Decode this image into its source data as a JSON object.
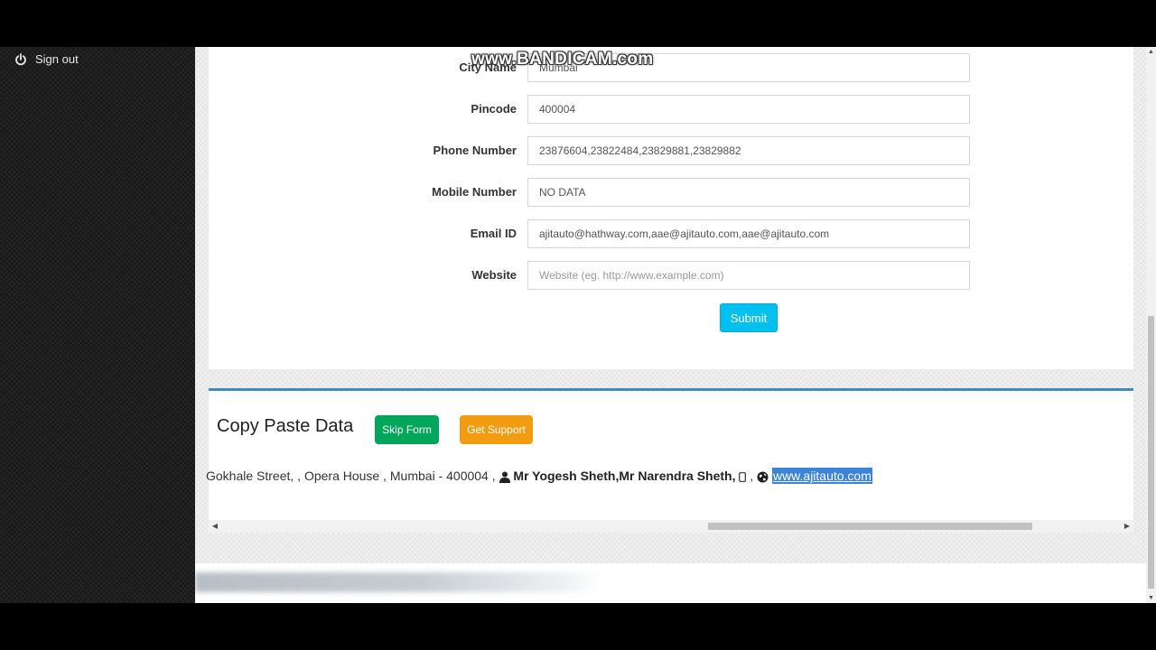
{
  "watermark": "www.BANDICAM.com",
  "sidebar": {
    "signout_label": "Sign out"
  },
  "form": {
    "fields": [
      {
        "label": "City Name",
        "value": "Mumbai",
        "placeholder": ""
      },
      {
        "label": "Pincode",
        "value": "400004",
        "placeholder": ""
      },
      {
        "label": "Phone Number",
        "value": "23876604,23822484,23829881,23829882",
        "placeholder": ""
      },
      {
        "label": "Mobile Number",
        "value": "NO DATA",
        "placeholder": ""
      },
      {
        "label": "Email ID",
        "value": "ajitauto@hathway.com,aae@ajitauto.com,aae@ajitauto.com",
        "placeholder": ""
      },
      {
        "label": "Website",
        "value": "",
        "placeholder": "Website (eg. http://www.example.com)"
      }
    ],
    "submit_label": "Submit"
  },
  "copy": {
    "title": "Copy Paste Data",
    "skip_label": "Skip Form",
    "support_label": "Get Support",
    "address_text": "Gokhale Street, , Opera House , Mumbai - 400004 ,",
    "contact_names": "Mr Yogesh Sheth,Mr Narendra Sheth,",
    "mobile_text": " ,",
    "website_link": "www.ajitauto.com"
  },
  "colors": {
    "submit": "#00c0ef",
    "skip": "#00a65a",
    "support": "#f39c12",
    "card_accent": "#3c8dbc",
    "selection": "#3b84d8"
  },
  "icons": [
    "power-icon",
    "user-icon",
    "mobile-icon",
    "globe-icon"
  ]
}
